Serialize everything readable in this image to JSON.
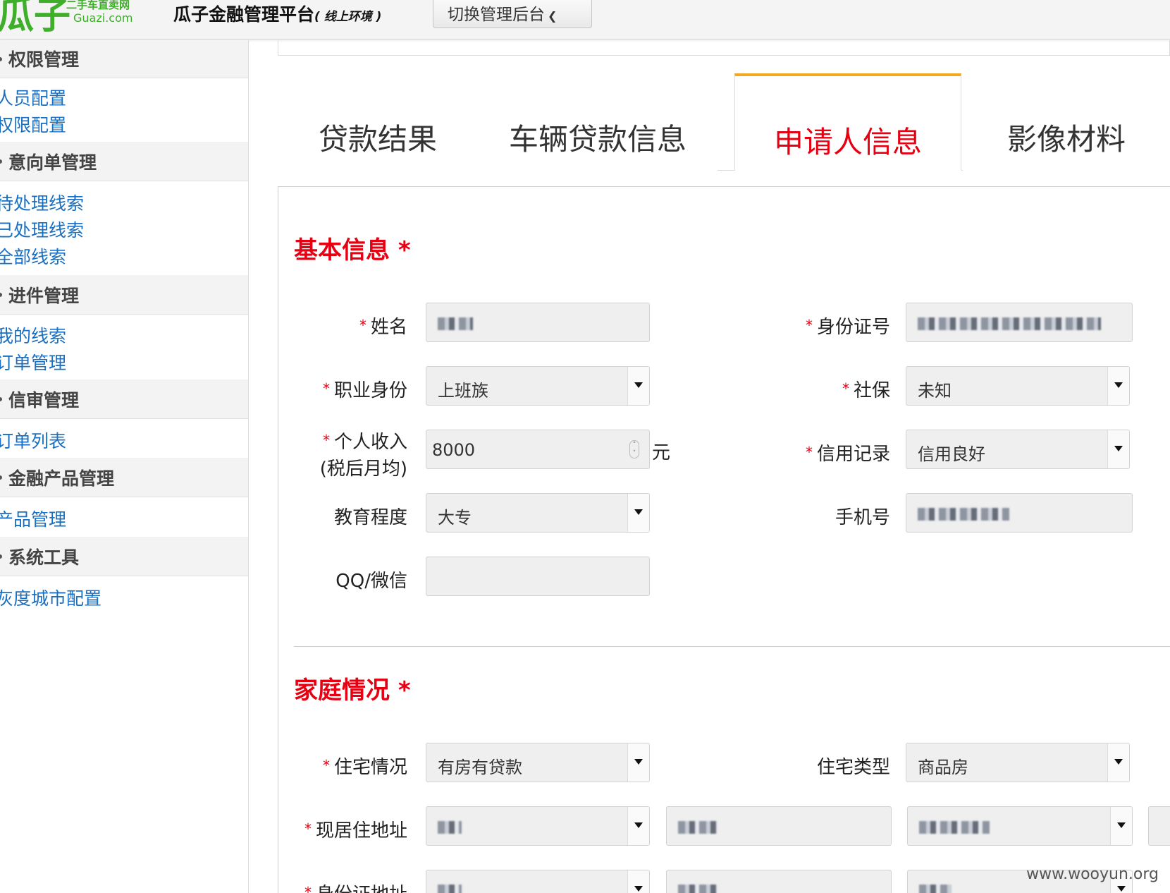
{
  "header": {
    "logo_text": "瓜子",
    "logo_sub": "二手车直卖网",
    "logo_domain": "Guazi.com",
    "app_title": "瓜子金融管理平台",
    "env_label": "( 线上环境 )",
    "switch_label": "切换管理后台"
  },
  "sidebar": {
    "sections": [
      {
        "title": "权限管理",
        "items": [
          "人员配置",
          "权限配置"
        ]
      },
      {
        "title": "意向单管理",
        "items": [
          "待处理线索",
          "已处理线索",
          "全部线索"
        ]
      },
      {
        "title": "进件管理",
        "items": [
          "我的线索",
          "订单管理"
        ]
      },
      {
        "title": "信审管理",
        "items": [
          "订单列表"
        ]
      },
      {
        "title": "金融产品管理",
        "items": [
          "产品管理"
        ]
      },
      {
        "title": "系统工具",
        "items": [
          "灰度城市配置"
        ]
      }
    ]
  },
  "tabs": [
    {
      "label": "贷款结果",
      "active": false
    },
    {
      "label": "车辆贷款信息",
      "active": false
    },
    {
      "label": "申请人信息",
      "active": true
    },
    {
      "label": "影像材料",
      "active": false
    }
  ],
  "basic_info": {
    "title": "基本信息",
    "required_mark": "*",
    "name": {
      "label": "姓名",
      "required": true
    },
    "id_number": {
      "label": "身份证号",
      "required": true
    },
    "occupation": {
      "label": "职业身份",
      "required": true,
      "value": "上班族"
    },
    "social_security": {
      "label": "社保",
      "required": true,
      "value": "未知"
    },
    "income": {
      "label_line1": "个人收入",
      "label_line2": "(税后月均)",
      "required": true,
      "value": "8000",
      "unit": "元"
    },
    "credit": {
      "label": "信用记录",
      "required": true,
      "value": "信用良好"
    },
    "education": {
      "label": "教育程度",
      "required": false,
      "value": "大专"
    },
    "phone": {
      "label": "手机号",
      "required": false
    },
    "qq_wechat": {
      "label": "QQ/微信",
      "required": false,
      "value": ""
    }
  },
  "family_info": {
    "title": "家庭情况",
    "required_mark": "*",
    "housing": {
      "label": "住宅情况",
      "required": true,
      "value": "有房有贷款"
    },
    "housing_type": {
      "label": "住宅类型",
      "required": false,
      "value": "商品房"
    },
    "current_address": {
      "label": "现居住地址",
      "required": true
    },
    "id_address": {
      "label": "身份证地址",
      "required": true
    }
  },
  "watermark": "www.wooyun.org",
  "colors": {
    "accent_red": "#e60012",
    "tab_highlight": "#f5a623",
    "link_blue": "#1a6fc0",
    "logo_green": "#3fae2a"
  }
}
